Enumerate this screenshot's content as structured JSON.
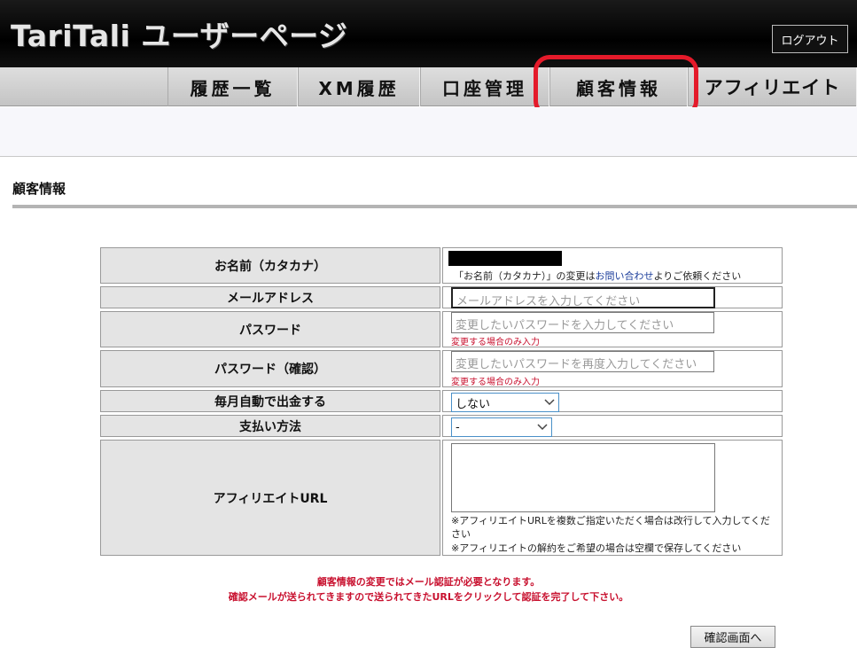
{
  "header": {
    "site_title": "TariTali ユーザーページ",
    "logout_label": "ログアウト"
  },
  "nav": {
    "items": [
      {
        "label": "履歴一覧"
      },
      {
        "label": "XM履歴"
      },
      {
        "label": "口座管理"
      },
      {
        "label": "顧客情報"
      },
      {
        "label": "アフィリエイト"
      }
    ],
    "highlight_color": "#e41a2a"
  },
  "section": {
    "title": "顧客情報"
  },
  "form": {
    "name": {
      "label": "お名前（カタカナ）",
      "note_prefix": "「お名前（カタカナ）」の変更は",
      "note_link": "お問い合わせ",
      "note_suffix": "よりご依頼ください"
    },
    "email": {
      "label": "メールアドレス",
      "placeholder": "メールアドレスを入力してください"
    },
    "password": {
      "label": "パスワード",
      "placeholder": "変更したいパスワードを入力してください",
      "hint": "変更する場合のみ入力"
    },
    "password_confirm": {
      "label": "パスワード（確認）",
      "placeholder": "変更したいパスワードを再度入力してください",
      "hint": "変更する場合のみ入力"
    },
    "auto_withdraw": {
      "label": "毎月自動で出金する",
      "selected": "しない"
    },
    "payment_method": {
      "label": "支払い方法",
      "selected": "-"
    },
    "affiliate_url": {
      "label": "アフィリエイトURL",
      "note1": "※アフィリエイトURLを複数ご指定いただく場合は改行して入力してください",
      "note2": "※アフィリエイトの解約をご希望の場合は空欄で保存してください"
    }
  },
  "notice": {
    "line1": "顧客情報の変更ではメール認証が必要となります。",
    "line2": "確認メールが送られてきますので送られてきたURLをクリックして認証を完了して下さい。"
  },
  "confirm_button_label": "確認画面へ"
}
